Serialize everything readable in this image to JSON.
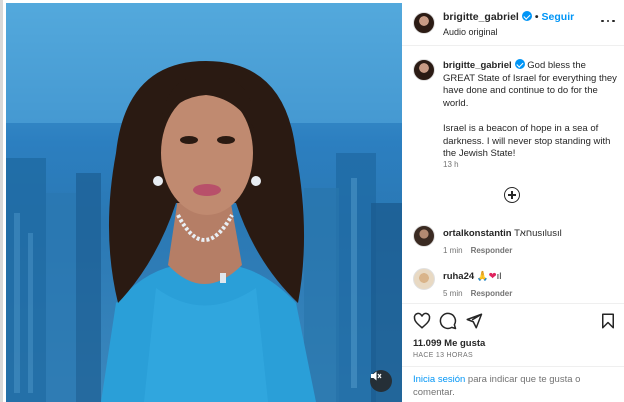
{
  "post": {
    "username": "brigitte_gabriel",
    "separator": "•",
    "follow_label": "Seguir",
    "audio_label": "Audio original"
  },
  "caption": {
    "username": "brigitte_gabriel",
    "text": "God bless the GREAT State of Israel for everything they have done and continue to do for the world.\n\nIsrael is a beacon of hope in a sea of darkness. I will never stop standing with the Jewish State!",
    "time": "13 h"
  },
  "comments": [
    {
      "username": "ortalkonstantin",
      "text": "Tחאusılusıl",
      "time": "1 min",
      "reply_label": "Responder"
    },
    {
      "username": "ruha24",
      "text": "🙏",
      "heart": "❤",
      "suffix": "ıl",
      "time": "5 min",
      "reply_label": "Responder"
    }
  ],
  "engagement": {
    "likes": "11.099 Me gusta",
    "ago": "HACE 13 HORAS"
  },
  "login": {
    "link_label": "Inicia sesión",
    "rest_text": " para indicar que te gusta o comentar."
  },
  "icons": {
    "more": "more-options-icon",
    "add": "add-comment-icon",
    "like": "heart-icon",
    "comment": "comment-icon",
    "share": "share-icon",
    "save": "bookmark-icon",
    "mute": "muted-speaker-icon"
  },
  "colors": {
    "accent": "#0095f6",
    "text": "#262626",
    "secondary": "#737373",
    "video_bg": "#2c7fc0",
    "dress": "#2a9fd8"
  }
}
